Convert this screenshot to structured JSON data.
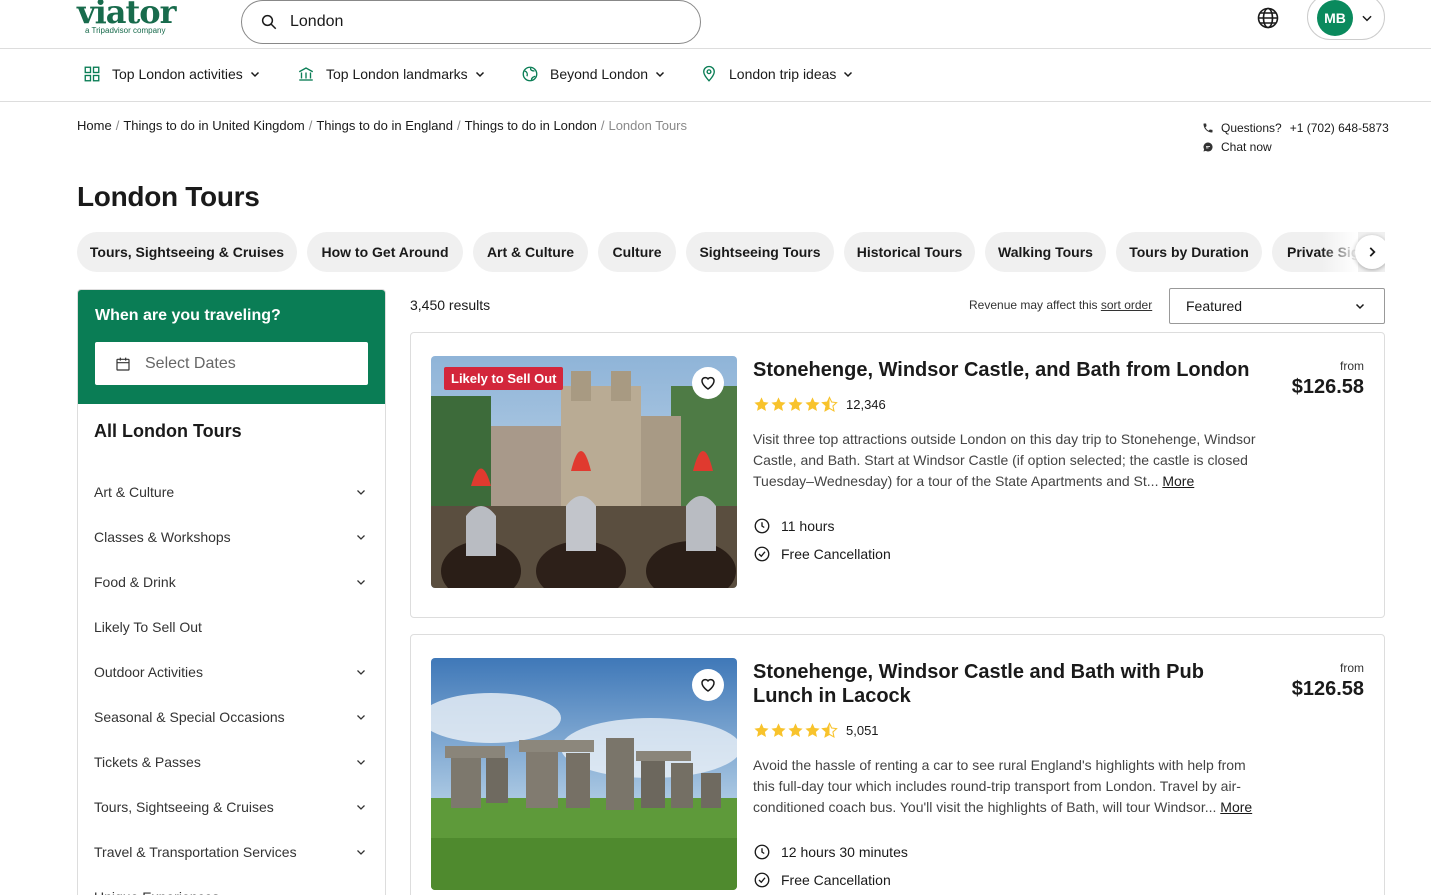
{
  "header": {
    "logo": "viator",
    "logo_tagline": "a Tripadvisor company",
    "search_value": "London",
    "avatar_initials": "MB"
  },
  "nav": [
    {
      "label": "Top London activities",
      "icon": "grid-icon"
    },
    {
      "label": "Top London landmarks",
      "icon": "landmark-icon"
    },
    {
      "label": "Beyond London",
      "icon": "globe-icon"
    },
    {
      "label": "London trip ideas",
      "icon": "location-pin-icon"
    }
  ],
  "breadcrumb": [
    "Home",
    "Things to do in United Kingdom",
    "Things to do in England",
    "Things to do in London",
    "London Tours"
  ],
  "contact": {
    "questions_label": "Questions?",
    "phone": "+1 (702) 648-5873",
    "chat_label": "Chat now"
  },
  "page_title": "London Tours",
  "pills": [
    "Tours, Sightseeing & Cruises",
    "How to Get Around",
    "Art & Culture",
    "Culture",
    "Sightseeing Tours",
    "Historical Tours",
    "Walking Tours",
    "Tours by Duration",
    "Private Sightseeing Tours"
  ],
  "sidebar": {
    "traveling_title": "When are you traveling?",
    "select_dates": "Select Dates",
    "categories_title": "All London Tours",
    "categories": [
      {
        "label": "Art & Culture",
        "expandable": true
      },
      {
        "label": "Classes & Workshops",
        "expandable": true
      },
      {
        "label": "Food & Drink",
        "expandable": true
      },
      {
        "label": "Likely To Sell Out",
        "expandable": false
      },
      {
        "label": "Outdoor Activities",
        "expandable": true
      },
      {
        "label": "Seasonal & Special Occasions",
        "expandable": true
      },
      {
        "label": "Tickets & Passes",
        "expandable": true
      },
      {
        "label": "Tours, Sightseeing & Cruises",
        "expandable": true
      },
      {
        "label": "Travel & Transportation Services",
        "expandable": true
      },
      {
        "label": "Unique Experiences",
        "expandable": false
      }
    ]
  },
  "results": {
    "count": "3,450 results",
    "revenue_note": "Revenue may affect this",
    "sort_order_link": "sort order",
    "sort_selected": "Featured"
  },
  "products": [
    {
      "badge": "Likely to Sell Out",
      "title": "Stonehenge, Windsor Castle, and Bath from London",
      "rating": 4.5,
      "reviews": "12,346",
      "description": "Visit three top attractions outside London on this day trip to Stonehenge, Windsor Castle, and Bath. Start at Windsor Castle (if option selected; the castle is closed Tuesday–Wednesday) for a tour of the State Apartments and St...",
      "more": "More",
      "duration": "11 hours",
      "cancellation": "Free Cancellation",
      "price_from": "from",
      "price": "$126.58"
    },
    {
      "badge": "",
      "title": "Stonehenge, Windsor Castle and Bath with Pub Lunch in Lacock",
      "rating": 4.5,
      "reviews": "5,051",
      "description": "Avoid the hassle of renting a car to see rural England's highlights with help from this full-day tour which includes round-trip transport from London. Travel by air-conditioned coach bus. You'll visit the highlights of Bath, will tour Windsor...",
      "more": "More",
      "duration": "12 hours 30 minutes",
      "cancellation": "Free Cancellation",
      "price_from": "from",
      "price": "$126.58"
    }
  ],
  "colors": {
    "brand": "#186b4c",
    "accent_green": "#0a7d55",
    "badge_red": "#d3263b",
    "star": "#f8c32c"
  }
}
